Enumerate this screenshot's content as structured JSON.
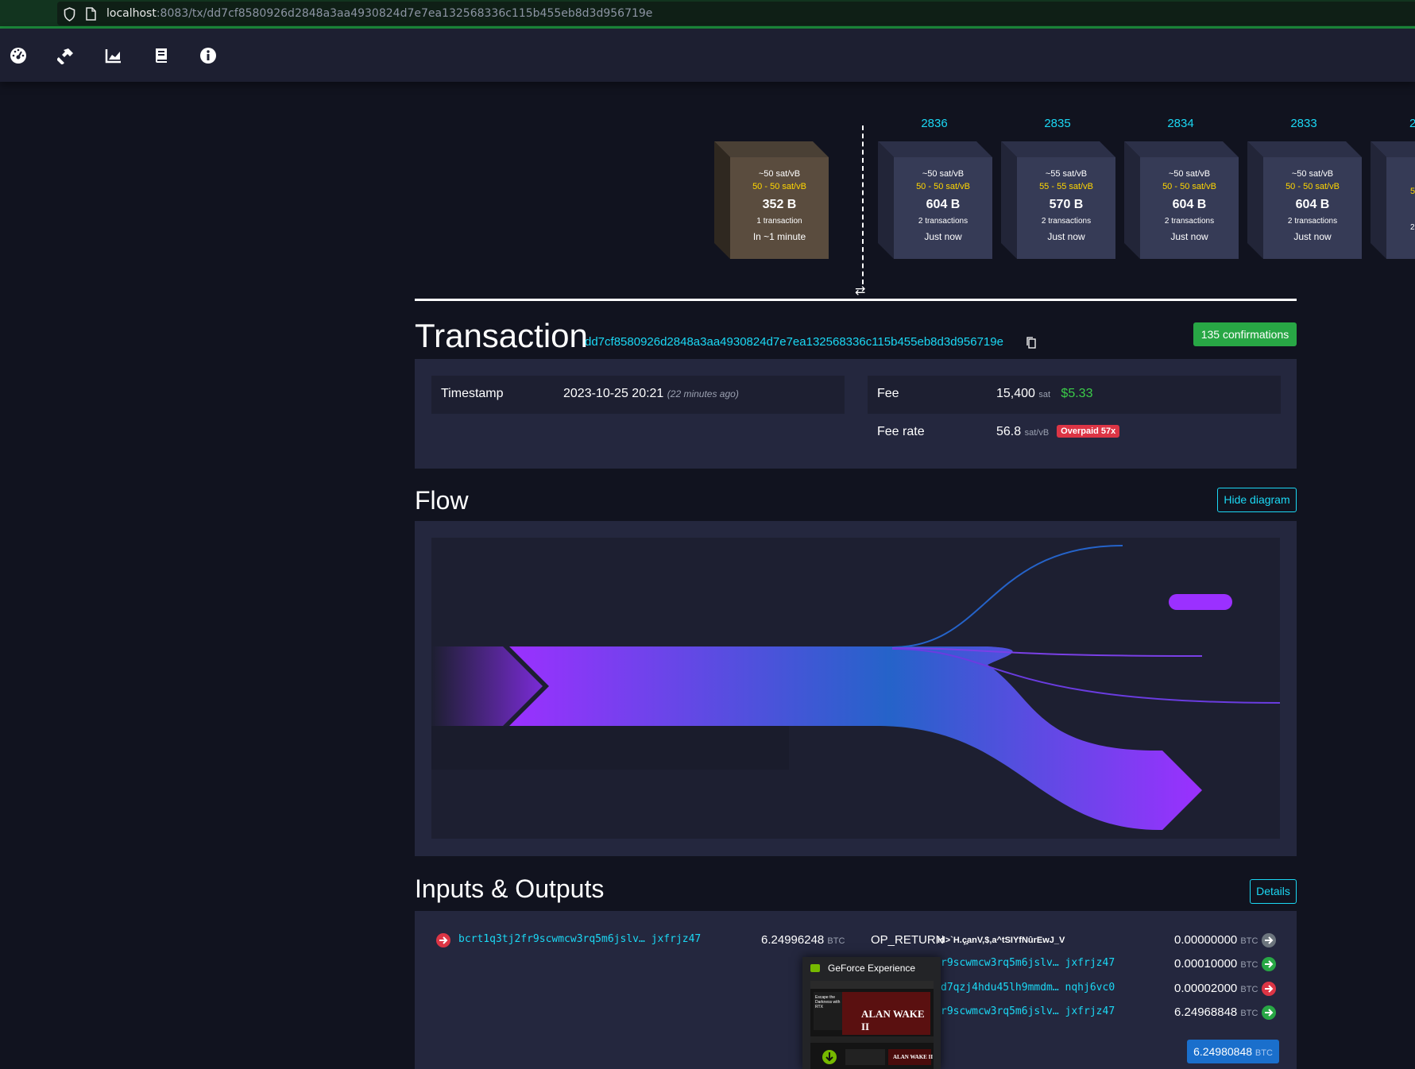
{
  "browser": {
    "url_host": "localhost",
    "url_path": ":8083/tx/dd7cf8580926d2848a3aa4930824d7e7ea132568336c115b455eb8d3d956719e"
  },
  "nav": {
    "icons": [
      "dashboard-icon",
      "hammer-icon",
      "chart-icon",
      "book-icon",
      "info-icon"
    ]
  },
  "blocks": {
    "pending": {
      "fee": "~50 sat/vB",
      "range": "50 - 50 sat/vB",
      "size": "352 B",
      "txs": "1 transaction",
      "time": "In ~1 minute"
    },
    "mined": [
      {
        "height": "2836",
        "fee": "~50 sat/vB",
        "range": "50 - 50 sat/vB",
        "size": "604 B",
        "txs": "2 transactions",
        "time": "Just now"
      },
      {
        "height": "2835",
        "fee": "~55 sat/vB",
        "range": "55 - 55 sat/vB",
        "size": "570 B",
        "txs": "2 transactions",
        "time": "Just now"
      },
      {
        "height": "2834",
        "fee": "~50 sat/vB",
        "range": "50 - 50 sat/vB",
        "size": "604 B",
        "txs": "2 transactions",
        "time": "Just now"
      },
      {
        "height": "2833",
        "fee": "~50 sat/vB",
        "range": "50 - 50 sat/vB",
        "size": "604 B",
        "txs": "2 transactions",
        "time": "Just now"
      }
    ],
    "partial_next_height": "2",
    "partial_range": "5",
    "partial_txs": "2"
  },
  "transaction": {
    "title": "Transaction",
    "txid": "dd7cf8580926d2848a3aa4930824d7e7ea132568336c115b455eb8d3d956719e",
    "confirmations": "135 confirmations",
    "timestamp_label": "Timestamp",
    "timestamp_value": "2023-10-25 20:21",
    "timestamp_ago": "(22 minutes ago)",
    "fee_label": "Fee",
    "fee_value": "15,400",
    "fee_unit": "sat",
    "fee_usd": "$5.33",
    "feerate_label": "Fee rate",
    "feerate_value": "56.8",
    "feerate_unit": "sat/vB",
    "overpaid": "Overpaid 57x"
  },
  "flow": {
    "title": "Flow",
    "hide_button": "Hide diagram"
  },
  "io": {
    "title": "Inputs & Outputs",
    "details_button": "Details",
    "inputs": [
      {
        "address": "bcrt1q3tj2fr9scwmcw3rq5m6jslv… jxfrjz47",
        "amount": "6.24996248",
        "unit": "BTC"
      }
    ],
    "outputs": [
      {
        "label": "OP_RETURN",
        "data": "id>`H.ç̧anV,$,a^tSIYfNûrEwJ_V",
        "amount": "0.00000000",
        "unit": "BTC",
        "status": "gray"
      },
      {
        "address": "r9scwmcw3rq5m6jslv… jxfrjz47",
        "amount": "0.00010000",
        "unit": "BTC",
        "status": "green"
      },
      {
        "address": "d7qzj4hdu45lh9mmdm… nqhj6vc0",
        "amount": "0.00002000",
        "unit": "BTC",
        "status": "red"
      },
      {
        "address": "r9scwmcw3rq5m6jslv… jxfrjz47",
        "amount": "6.24968848",
        "unit": "BTC",
        "status": "green"
      }
    ],
    "total": "6.24980848",
    "total_unit": "BTC"
  },
  "popup": {
    "title": "GeForce Experience",
    "thumb_text": "ALAN WAKE II",
    "thumb_small": "ALAN WAKE II",
    "thumb_caption": "Escape the Darkness with RTX"
  }
}
